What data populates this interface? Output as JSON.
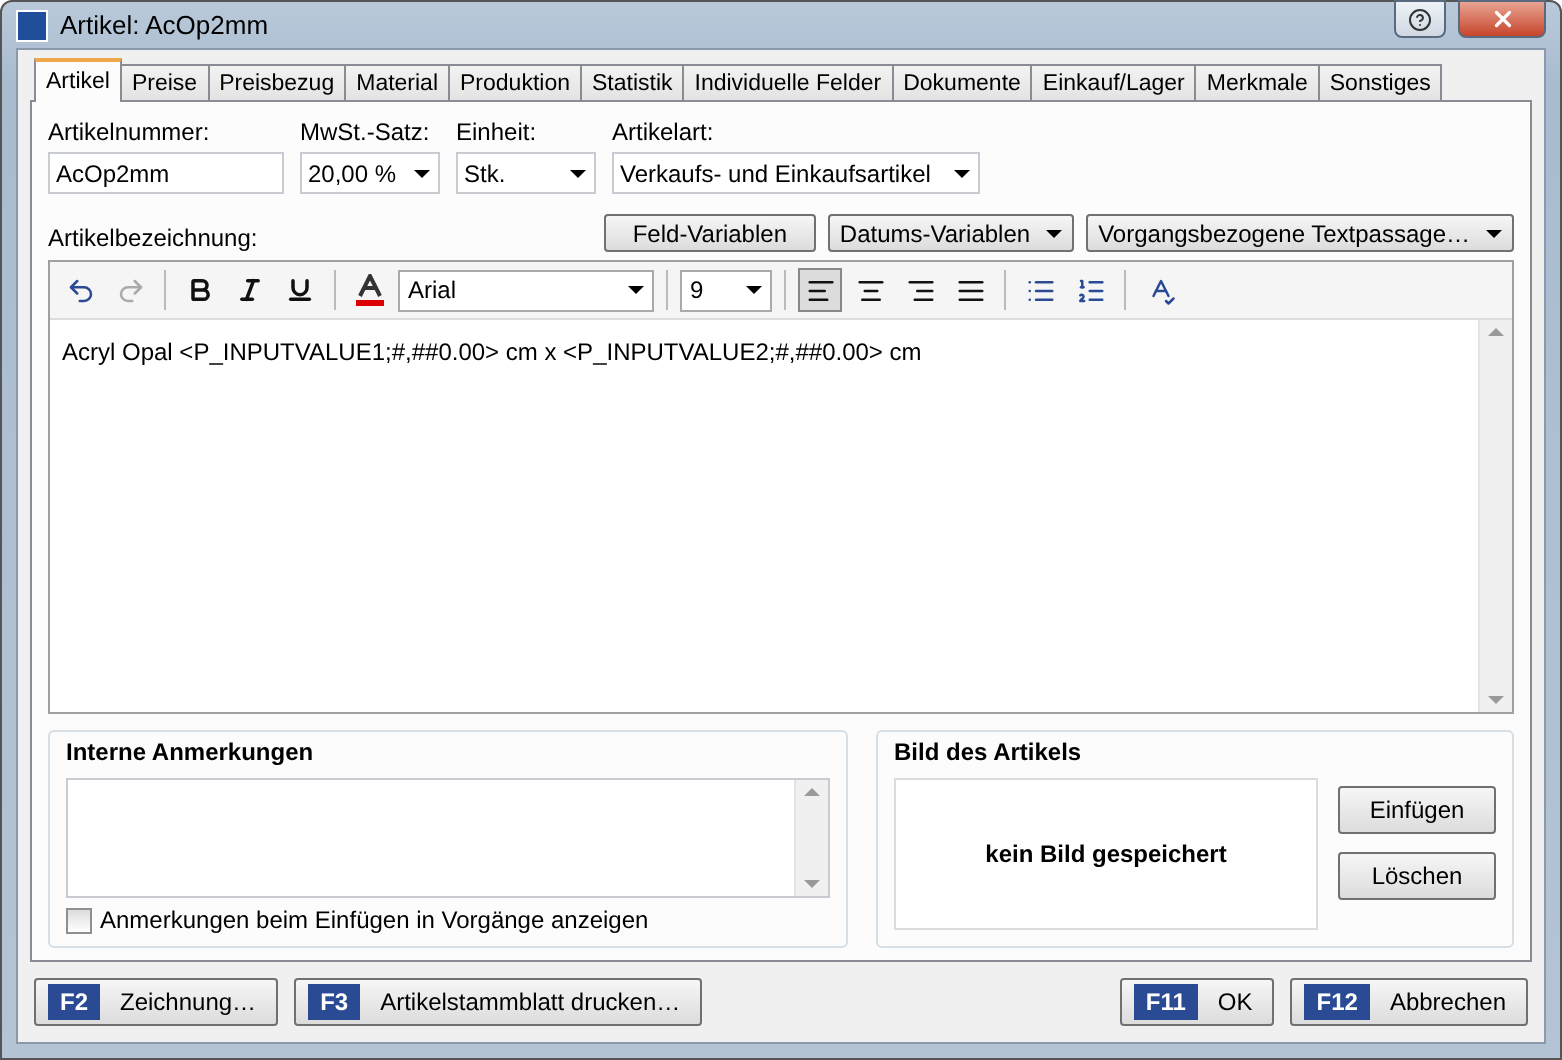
{
  "window": {
    "title": "Artikel: AcOp2mm"
  },
  "tabs": [
    {
      "label": "Artikel",
      "selected": true
    },
    {
      "label": "Preise",
      "selected": false
    },
    {
      "label": "Preisbezug",
      "selected": false
    },
    {
      "label": "Material",
      "selected": false
    },
    {
      "label": "Produktion",
      "selected": false
    },
    {
      "label": "Statistik",
      "selected": false
    },
    {
      "label": "Individuelle Felder",
      "selected": false
    },
    {
      "label": "Dokumente",
      "selected": false
    },
    {
      "label": "Einkauf/Lager",
      "selected": false
    },
    {
      "label": "Merkmale",
      "selected": false
    },
    {
      "label": "Sonstiges",
      "selected": false
    }
  ],
  "fields": [
    {
      "label": "Artikelnummer:",
      "value": "AcOp2mm",
      "kind": "input"
    },
    {
      "label": "MwSt.-Satz:",
      "value": "20,00 %",
      "kind": "select"
    },
    {
      "label": "Einheit:",
      "value": "Stk.",
      "kind": "select"
    },
    {
      "label": "Artikelart:",
      "value": "Verkaufs- und Einkaufsartikel",
      "kind": "select"
    }
  ],
  "description": {
    "label": "Artikelbezeichnung:",
    "buttons": [
      {
        "label": "Feld-Variablen",
        "dropdown": false
      },
      {
        "label": "Datums-Variablen",
        "dropdown": true
      },
      {
        "label": "Vorgangsbezogene Textpassage…",
        "dropdown": true
      }
    ],
    "toolbar": {
      "redo_disabled": true,
      "font": "Arial",
      "size": "9",
      "alignments": [
        {
          "kind": "left",
          "selected": true
        },
        {
          "kind": "center",
          "selected": false
        },
        {
          "kind": "right",
          "selected": false
        },
        {
          "kind": "justify",
          "selected": false
        }
      ]
    },
    "text": "Acryl Opal <P_INPUTVALUE1;#,##0.00> cm x <P_INPUTVALUE2;#,##0.00> cm"
  },
  "notes": {
    "title": "Interne Anmerkungen",
    "checkbox": {
      "label": "Anmerkungen beim Einfügen in Vorgänge anzeigen",
      "checked": false
    }
  },
  "image": {
    "title": "Bild des Artikels",
    "placeholder": "kein Bild gespeichert",
    "buttons": [
      "Einfügen",
      "Löschen"
    ]
  },
  "footer": {
    "left": [
      {
        "key": "F2",
        "label": "Zeichnung…"
      },
      {
        "key": "F3",
        "label": "Artikelstammblatt drucken…"
      }
    ],
    "right": [
      {
        "key": "F11",
        "label": "OK"
      },
      {
        "key": "F12",
        "label": "Abbrechen"
      }
    ]
  }
}
